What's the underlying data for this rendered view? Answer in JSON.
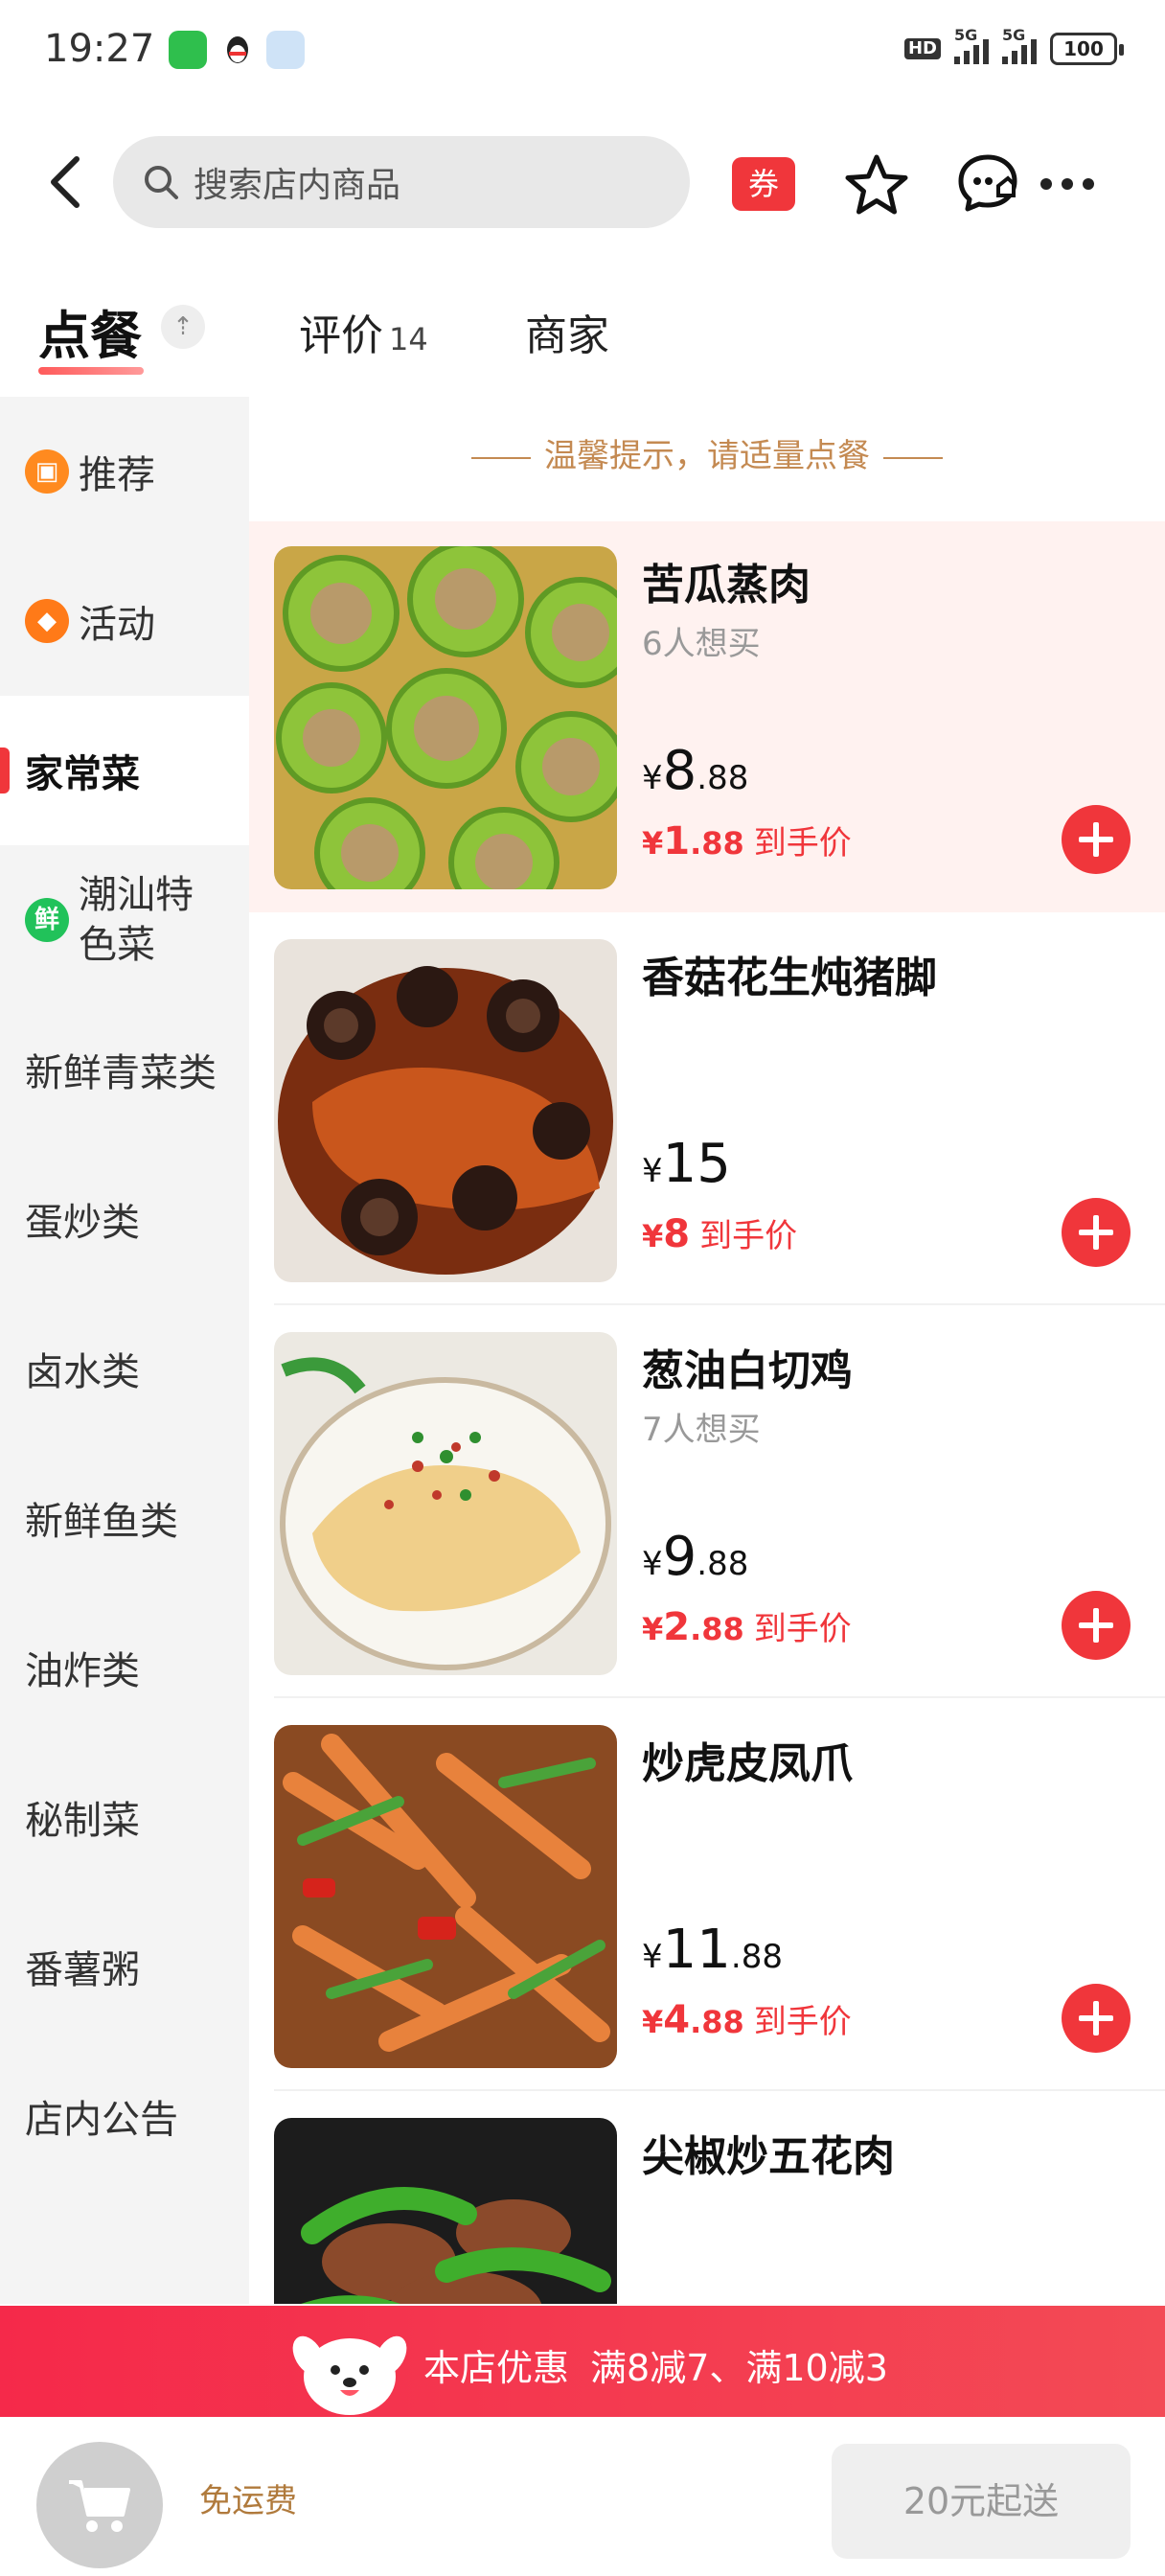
{
  "status_bar": {
    "time": "19:27",
    "battery": "100",
    "network": "5G",
    "hd": "HD"
  },
  "header": {
    "search_placeholder": "搜索店内商品",
    "coupon_label": "券"
  },
  "tabs": {
    "order": "点餐",
    "reviews": "评价",
    "reviews_count": "14",
    "shop": "商家"
  },
  "sidebar": {
    "items": [
      {
        "label": "推荐",
        "icon": "recommend-icon"
      },
      {
        "label": "活动",
        "icon": "activity-icon"
      },
      {
        "label": "家常菜"
      },
      {
        "label_line1": "潮汕特",
        "label_line2": "色菜",
        "icon_text": "鲜"
      },
      {
        "label": "新鲜青菜类"
      },
      {
        "label": "蛋炒类"
      },
      {
        "label": "卤水类"
      },
      {
        "label": "新鲜鱼类"
      },
      {
        "label": "油炸类"
      },
      {
        "label": "秘制菜"
      },
      {
        "label": "番薯粥"
      },
      {
        "label": "店内公告"
      }
    ]
  },
  "tip": "温馨提示，请适量点餐",
  "products": [
    {
      "name": "苦瓜蒸肉",
      "want": "6人想买",
      "currency": "¥",
      "price_int": "8",
      "price_dec": ".88",
      "deal_int": "1",
      "deal_dec": ".88",
      "deal_label": "到手价"
    },
    {
      "name": "香菇花生炖猪脚",
      "want": "",
      "currency": "¥",
      "price_int": "15",
      "price_dec": "",
      "deal_int": "8",
      "deal_dec": "",
      "deal_label": "到手价"
    },
    {
      "name": "葱油白切鸡",
      "want": "7人想买",
      "currency": "¥",
      "price_int": "9",
      "price_dec": ".88",
      "deal_int": "2",
      "deal_dec": ".88",
      "deal_label": "到手价"
    },
    {
      "name": "炒虎皮凤爪",
      "want": "",
      "currency": "¥",
      "price_int": "11",
      "price_dec": ".88",
      "deal_int": "4",
      "deal_dec": ".88",
      "deal_label": "到手价"
    },
    {
      "name": "尖椒炒五花肉",
      "want": "",
      "currency": "",
      "price_int": "",
      "price_dec": "",
      "deal_int": "",
      "deal_dec": "",
      "deal_label": ""
    }
  ],
  "promo": {
    "label": "本店优惠",
    "offers": "满8减7、满10减3"
  },
  "bottom": {
    "free_shipping": "免运费",
    "min_order": "20元起送"
  },
  "colors": {
    "accent": "#f0363b",
    "tip": "#c48a52",
    "highlight_bg": "#fff2f0"
  }
}
